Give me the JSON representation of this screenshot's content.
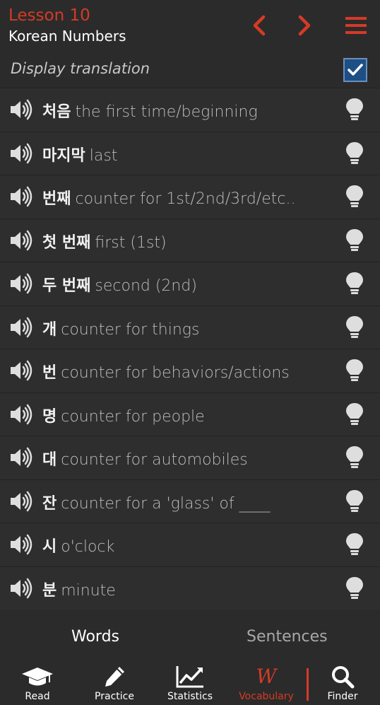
{
  "header": {
    "lesson": "Lesson 10",
    "title": "Korean Numbers",
    "accent_color": "#d63a26"
  },
  "toggle": {
    "label": "Display translation",
    "checked": true
  },
  "words": [
    {
      "ko": "처음",
      "en": "the first time/beginning"
    },
    {
      "ko": "마지막",
      "en": "last"
    },
    {
      "ko": "번째",
      "en": "counter for 1st/2nd/3rd/etc.."
    },
    {
      "ko": "첫 번째",
      "en": "first (1st)"
    },
    {
      "ko": "두 번째",
      "en": "second (2nd)"
    },
    {
      "ko": "개",
      "en": "counter for things"
    },
    {
      "ko": "번",
      "en": "counter for behaviors/actions"
    },
    {
      "ko": "명",
      "en": "counter for people"
    },
    {
      "ko": "대",
      "en": "counter for automobiles"
    },
    {
      "ko": "잔",
      "en": "counter for a 'glass' of ____"
    },
    {
      "ko": "시",
      "en": "o'clock"
    },
    {
      "ko": "분",
      "en": "minute"
    }
  ],
  "tabs": {
    "words": "Words",
    "sentences": "Sentences",
    "active": "words"
  },
  "nav": {
    "read": "Read",
    "practice": "Practice",
    "statistics": "Statistics",
    "vocabulary": "Vocabulary",
    "vocabulary_glyph": "W",
    "finder": "Finder",
    "active": "vocabulary"
  }
}
